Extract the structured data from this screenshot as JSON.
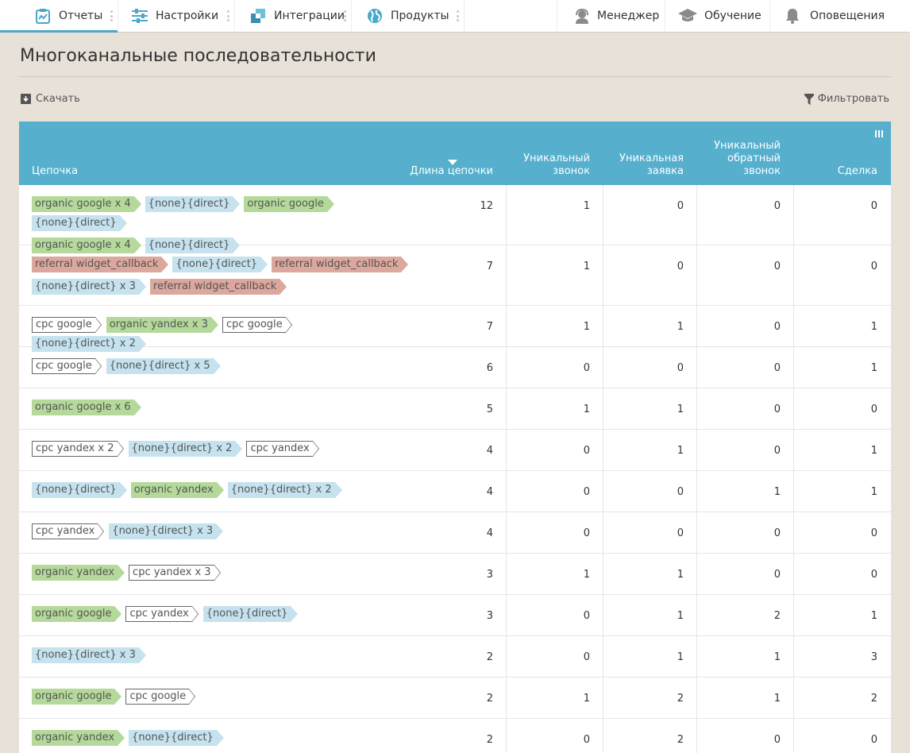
{
  "nav": {
    "left": [
      {
        "label": "Отчеты",
        "icon": "reports-icon"
      },
      {
        "label": "Настройки",
        "icon": "settings-sliders-icon"
      },
      {
        "label": "Интеграции",
        "icon": "integrations-icon"
      },
      {
        "label": "Продукты",
        "icon": "products-globe-icon"
      }
    ],
    "right": [
      {
        "label": "Менеджер",
        "icon": "manager-icon"
      },
      {
        "label": "Обучение",
        "icon": "graduation-cap-icon"
      },
      {
        "label": "Оповещения",
        "icon": "bell-icon"
      }
    ]
  },
  "page": {
    "title": "Многоканальные последовательности",
    "download_label": "Скачать",
    "filter_label": "Фильтровать"
  },
  "table": {
    "headers": {
      "chain": "Цепочка",
      "length": "Длина цепочки",
      "call_1": "Уникальный",
      "call_2": "звонок",
      "lead_1": "Уникальная",
      "lead_2": "заявка",
      "callback_1": "Уникальный",
      "callback_2": "обратный",
      "callback_3": "звонок",
      "deal": "Сделка"
    },
    "rows": [
      {
        "tags": [
          [
            "organic google x 4",
            "green"
          ],
          [
            "{none}{direct}",
            "blue"
          ],
          [
            "organic google",
            "green"
          ],
          [
            "{none}{direct}",
            "blue"
          ],
          [
            "organic google x 4",
            "green"
          ],
          [
            "{none}{direct}",
            "blue"
          ]
        ],
        "length": "12",
        "call": "1",
        "lead": "0",
        "callback": "0",
        "deal": "0"
      },
      {
        "tags": [
          [
            "referral widget_callback",
            "red"
          ],
          [
            "{none}{direct}",
            "blue"
          ],
          [
            "referral widget_callback",
            "red"
          ],
          [
            "{none}{direct} x 3",
            "blue"
          ],
          [
            "referral widget_callback",
            "red"
          ]
        ],
        "length": "7",
        "call": "1",
        "lead": "0",
        "callback": "0",
        "deal": "0"
      },
      {
        "tags": [
          [
            "cpc google",
            "white"
          ],
          [
            "organic yandex x 3",
            "green"
          ],
          [
            "cpc google",
            "white"
          ],
          [
            "{none}{direct} x 2",
            "blue"
          ]
        ],
        "length": "7",
        "call": "1",
        "lead": "1",
        "callback": "0",
        "deal": "1"
      },
      {
        "tags": [
          [
            "cpc google",
            "white"
          ],
          [
            "{none}{direct} x 5",
            "blue"
          ]
        ],
        "length": "6",
        "call": "0",
        "lead": "0",
        "callback": "0",
        "deal": "1"
      },
      {
        "tags": [
          [
            "organic google x 6",
            "green"
          ]
        ],
        "length": "5",
        "call": "1",
        "lead": "1",
        "callback": "0",
        "deal": "0"
      },
      {
        "tags": [
          [
            "cpc yandex x 2",
            "white"
          ],
          [
            "{none}{direct} x 2",
            "blue"
          ],
          [
            "cpc yandex",
            "white"
          ]
        ],
        "length": "4",
        "call": "0",
        "lead": "1",
        "callback": "0",
        "deal": "1"
      },
      {
        "tags": [
          [
            "{none}{direct}",
            "blue"
          ],
          [
            "organic yandex",
            "green"
          ],
          [
            "{none}{direct} x 2",
            "blue"
          ]
        ],
        "length": "4",
        "call": "0",
        "lead": "0",
        "callback": "1",
        "deal": "1"
      },
      {
        "tags": [
          [
            "cpc yandex",
            "white"
          ],
          [
            "{none}{direct} x 3",
            "blue"
          ]
        ],
        "length": "4",
        "call": "0",
        "lead": "0",
        "callback": "0",
        "deal": "0"
      },
      {
        "tags": [
          [
            "organic yandex",
            "green"
          ],
          [
            "cpc yandex x 3",
            "white"
          ]
        ],
        "length": "3",
        "call": "1",
        "lead": "1",
        "callback": "0",
        "deal": "0"
      },
      {
        "tags": [
          [
            "organic google",
            "green"
          ],
          [
            "cpc yandex",
            "white"
          ],
          [
            "{none}{direct}",
            "blue"
          ]
        ],
        "length": "3",
        "call": "0",
        "lead": "1",
        "callback": "2",
        "deal": "1"
      },
      {
        "tags": [
          [
            "{none}{direct} x 3",
            "blue"
          ]
        ],
        "length": "2",
        "call": "0",
        "lead": "1",
        "callback": "1",
        "deal": "3"
      },
      {
        "tags": [
          [
            "organic google",
            "green"
          ],
          [
            "cpc google",
            "white"
          ]
        ],
        "length": "2",
        "call": "1",
        "lead": "2",
        "callback": "1",
        "deal": "2"
      },
      {
        "tags": [
          [
            "organic yandex",
            "green"
          ],
          [
            "{none}{direct}",
            "blue"
          ]
        ],
        "length": "2",
        "call": "0",
        "lead": "2",
        "callback": "0",
        "deal": "0"
      }
    ]
  },
  "colors": {
    "header_bg": "#55afcd",
    "accent": "#4aa8c8",
    "tag_organic": "#b4d99a",
    "tag_direct": "#c5e2ee",
    "tag_referral": "#dca79c",
    "page_bg": "#e8e1d8"
  }
}
